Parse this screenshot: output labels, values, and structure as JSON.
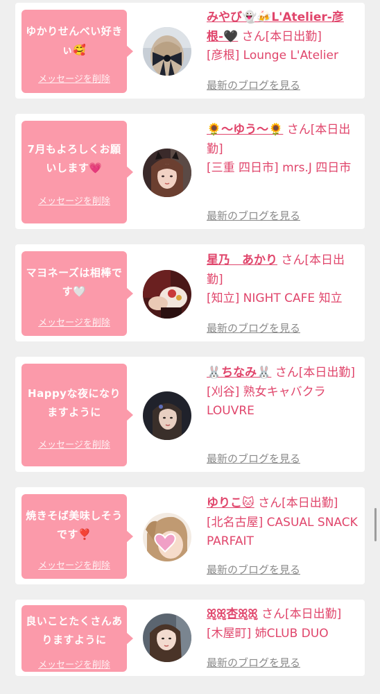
{
  "cards": [
    {
      "message": "ゆかりせんべい好きぃ🥰",
      "delete_label": "メッセージを削除",
      "name": "みやび👻🍻L'Atelier-彦根-🖤",
      "suffix": "さん[本日出勤]",
      "shop": "[彦根] Lounge L'Atelier",
      "blog_label": "最新のブログを見る",
      "avatar_icon": "hair-bow-photo"
    },
    {
      "message": "7月もよろしくお願いします💗",
      "delete_label": "メッセージを削除",
      "name": "🌻〜ゆう〜🌻",
      "suffix": "さん[本日出勤]",
      "shop": "[三重 四日市] mrs.J 四日市",
      "blog_label": "最新のブログを見る",
      "avatar_icon": "cat-ears-portrait"
    },
    {
      "message": "マヨネーズは相棒です🤍",
      "delete_label": "メッセージを削除",
      "name": "星乃　あかり",
      "suffix": "さん[本日出勤]",
      "shop": "[知立] NIGHT CAFE 知立",
      "blog_label": "最新のブログを見る",
      "avatar_icon": "hands-flowers-photo"
    },
    {
      "message": "Happyな夜になりますように",
      "delete_label": "メッセージを削除",
      "name": "🐰ちなみ🐰",
      "suffix": "さん[本日出勤]",
      "shop": "[刈谷] 熟女キャバクラ LOUVRE",
      "blog_label": "最新のブログを見る",
      "avatar_icon": "dark-portrait"
    },
    {
      "message": "焼きそば美味しそうです❣️",
      "delete_label": "メッセージを削除",
      "name": "ゆりこ🐱",
      "suffix": "さん[本日出勤]",
      "shop": "[北名古屋] CASUAL SNACK PARFAIT",
      "blog_label": "最新のブログを見る",
      "avatar_icon": "heart-sticker-portrait"
    },
    {
      "message": "良いことたくさんありますように",
      "delete_label": "メッセージを削除",
      "name": "ꕤ̫ꕤ̫杏ꕤ̫ꕤ̫",
      "suffix": "さん[本日出勤]",
      "shop": "[木屋町] 姉CLUB DUO",
      "blog_label": "最新のブログを見る",
      "avatar_icon": "long-hair-portrait"
    }
  ],
  "colors": {
    "page_bg": "#efefef",
    "card_bg": "#ffffff",
    "bubble_bg": "#fb9aaa",
    "accent_text": "#e0456b",
    "link_gray": "#8a8a8a"
  }
}
